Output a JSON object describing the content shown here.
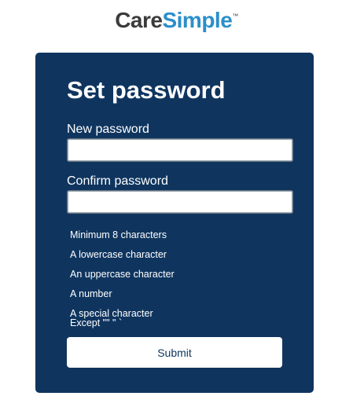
{
  "brand": {
    "logo_part1": "Care",
    "logo_part2": "Simple",
    "logo_tm": "™"
  },
  "form": {
    "title": "Set password",
    "new_password_label": "New password",
    "new_password_value": "",
    "confirm_password_label": "Confirm password",
    "confirm_password_value": "",
    "requirements": [
      "Minimum 8 characters",
      "A lowercase character",
      "An uppercase character",
      "A number",
      "A special character",
      "Except \"\" \" `"
    ],
    "submit_label": "Submit"
  },
  "colors": {
    "card_background": "#0f355f",
    "logo_dark": "#3b3b3b",
    "logo_accent": "#2a8fc9"
  }
}
